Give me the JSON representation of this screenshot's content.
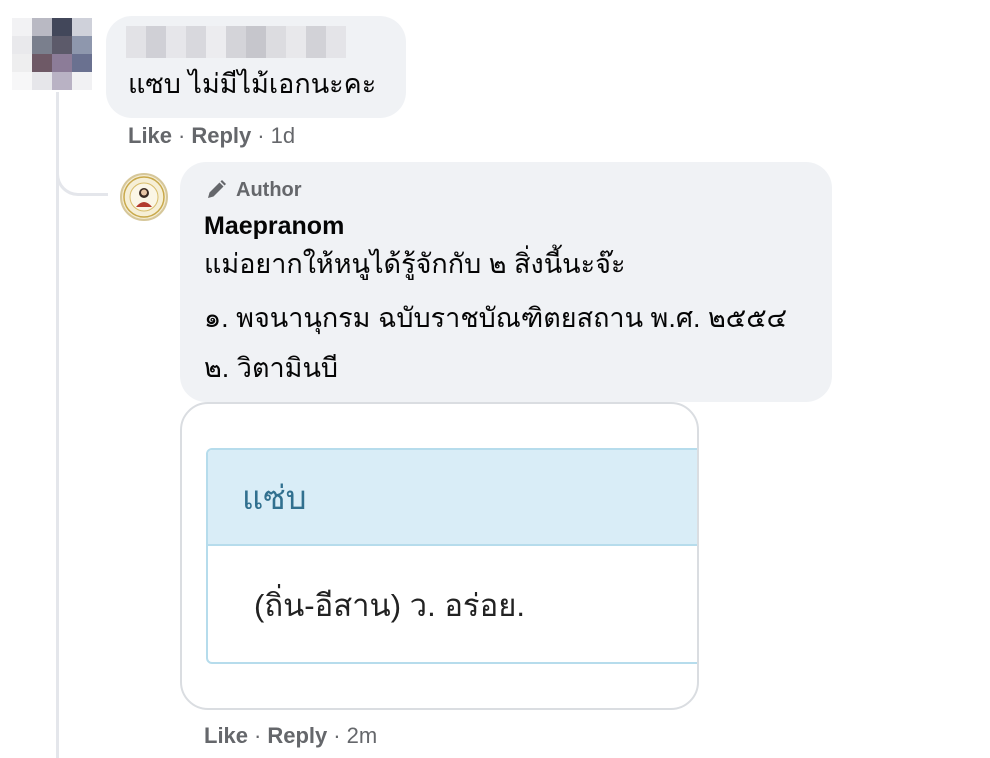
{
  "comment1": {
    "text": "แซบ ไม่มีไม้เอกนะคะ",
    "actions": {
      "like": "Like",
      "reply": "Reply",
      "time": "1d",
      "separator": "·"
    }
  },
  "reply": {
    "badge_label": "Author",
    "badge_icon": "pencil-icon",
    "author_name": "Maepranom",
    "lines": [
      "แม่อยากให้หนูได้รู้จักกับ ๒ สิ่งนี้นะจ๊ะ",
      "๑. พจนานุกรม ฉบับราชบัณฑิตยสถาน พ.ศ. ๒๕๕๔",
      "๒. วิตามินบี"
    ],
    "card": {
      "headword": "แซ่บ",
      "definition": "(ถิ่น-อีสาน) ว. อร่อย."
    },
    "actions": {
      "like": "Like",
      "reply": "Reply",
      "time": "2m",
      "separator": "·"
    }
  },
  "colors": {
    "bubble": "#f0f2f5",
    "meta_text": "#65676b",
    "card_header_bg": "#d9edf7",
    "card_header_text": "#31708f"
  }
}
